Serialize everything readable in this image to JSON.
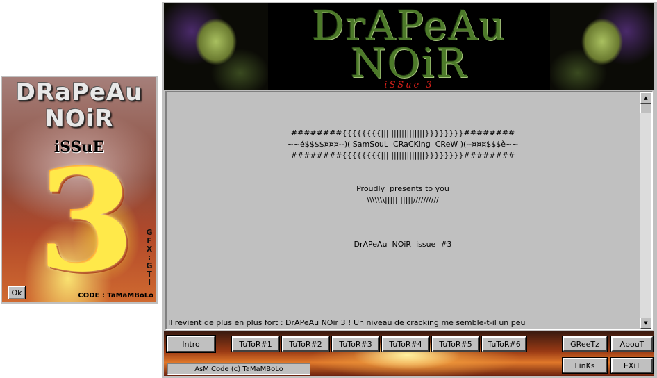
{
  "splash": {
    "title_line1": "DRaPeAu",
    "title_line2": "NOiR",
    "issue_label": "iSSuE",
    "issue_number": "3",
    "credits_gfx": "GFX : GTI",
    "credits_code": "CODE : TaMaMBoLo",
    "ok_label": "Ok"
  },
  "banner": {
    "title_line1": "DrAPeAu",
    "title_line2": "NOiR",
    "issue_label": "iSSue  3"
  },
  "text": {
    "lines": [
      "########{{{{{{{{|||||||||||||||||}}}}}}}}########",
      "~~é$$$$¤¤¤--)( SamSouL  CRaCKing  CReW )(--¤¤¤$$$è~~",
      "########{{{{{{{{|||||||||||||||||}}}}}}}}########",
      "Proudly  presents to you",
      "\\\\\\\\\\\\\\|||||||||||//////////",
      "DrAPeAu  NOiR  issue  #3"
    ],
    "bottom_line": "Il revient de plus en plus fort : DrAPeAu NOir 3 ! Un niveau de cracking me semble-t-il un peu"
  },
  "buttons": {
    "intro": "Intro",
    "tutors": [
      "TuToR#1",
      "TuToR#2",
      "TuToR#3",
      "TuToR#4",
      "TuToR#5",
      "TuToR#6"
    ],
    "greetz": "GReeTz",
    "about": "AbouT",
    "links": "LinKs",
    "exit": "EXiT"
  },
  "status": "AsM Code (c) TaMaMBoLo",
  "colors": {
    "window_gray": "#c0c0c0",
    "title_green": "#4d7a2a",
    "issue_red": "#d8201a",
    "splash_yellow": "#ffe94a"
  }
}
